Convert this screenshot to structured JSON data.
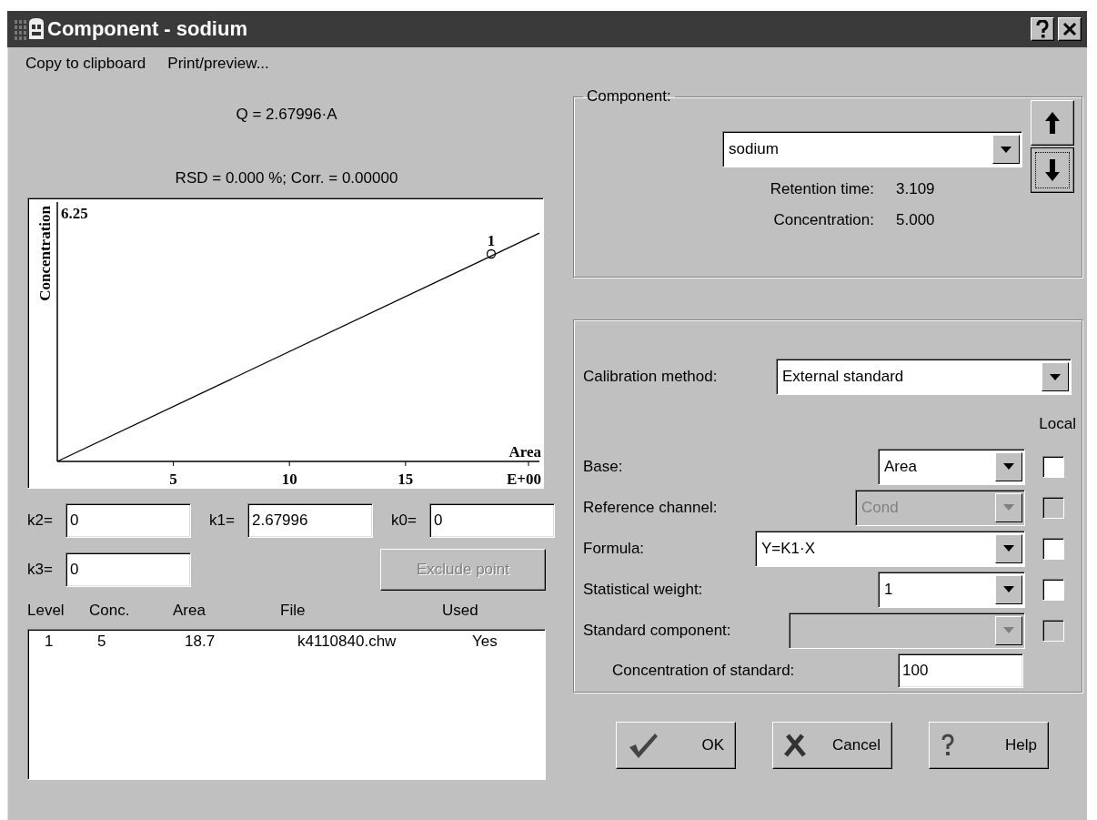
{
  "window": {
    "title": "Component - sodium"
  },
  "menu": [
    "Copy to clipboard",
    "Print/preview..."
  ],
  "equation": "Q = 2.67996·A",
  "statistics": "RSD = 0.000 %;  Corr. = 0.00000",
  "chart": {
    "xlabel": "Area",
    "ylabel": "Concentration",
    "x_tick_labels": [
      "5",
      "10",
      "15"
    ],
    "x_exponent": "E+00",
    "y_top_label": "6.25",
    "point_label": "1"
  },
  "coefficients": [
    {
      "label": "k2=",
      "value": "0"
    },
    {
      "label": "k1=",
      "value": "2.67996"
    },
    {
      "label": "k0=",
      "value": "0"
    },
    {
      "label": "k3=",
      "value": "0"
    }
  ],
  "exclude_button": {
    "label": "Exclude point",
    "disabled": true
  },
  "table": {
    "columns": [
      "Level",
      "Conc.",
      "Area",
      "File",
      "Used"
    ],
    "rows": [
      [
        "1",
        "5",
        "18.7",
        "k4110840.chw",
        "Yes"
      ]
    ]
  },
  "component_group": {
    "title": "Component:",
    "value": "sodium",
    "fields": [
      {
        "label": "Retention time:",
        "value": "3.109"
      },
      {
        "label": "Concentration:",
        "value": "5.000"
      }
    ]
  },
  "calibration": {
    "method_label": "Calibration method:",
    "method": "External standard",
    "local_label": "Local",
    "rows": [
      {
        "kind": "combo",
        "label": "Base:",
        "value": "Area",
        "disabled": false,
        "checked": false
      },
      {
        "kind": "combo",
        "label": "Reference channel:",
        "value": "Cond",
        "disabled": true,
        "checked": false
      },
      {
        "kind": "combo",
        "label": "Formula:",
        "value": "Y=K1·X",
        "disabled": false,
        "checked": false
      },
      {
        "kind": "combo",
        "label": "Statistical weight:",
        "value": "1",
        "disabled": false,
        "checked": false
      },
      {
        "kind": "combo",
        "label": "Standard component:",
        "disabled": true,
        "checked": false
      },
      {
        "kind": "input",
        "label": "Concentration of standard:",
        "value": "100"
      }
    ]
  },
  "buttons": [
    {
      "kind": "ok",
      "label": "OK"
    },
    {
      "kind": "cancel",
      "label": "Cancel"
    },
    {
      "kind": "help",
      "label": "Help"
    }
  ]
}
